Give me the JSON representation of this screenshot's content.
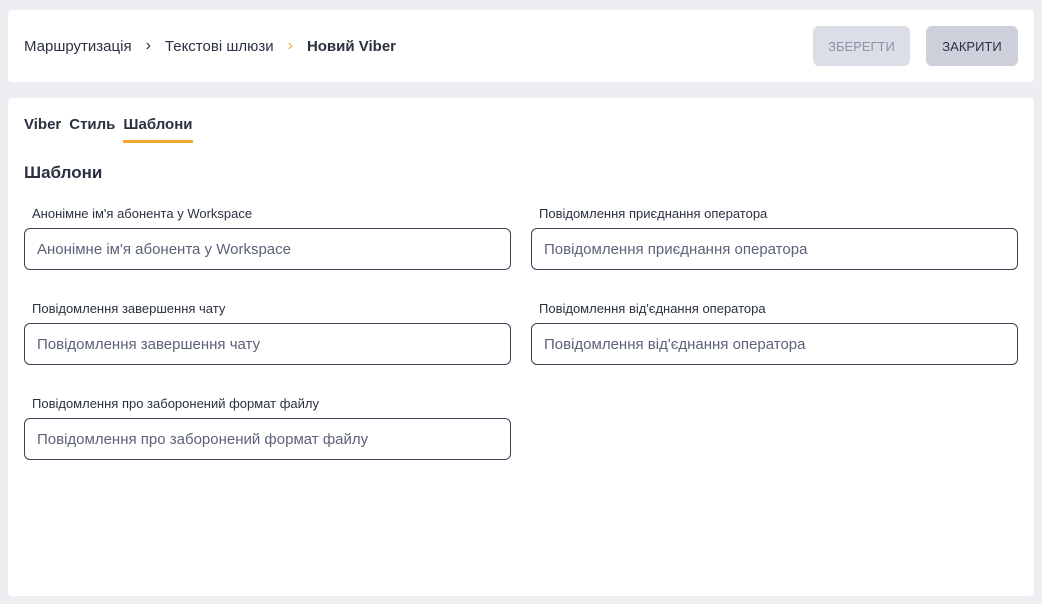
{
  "breadcrumb": {
    "items": [
      "Маршрутизація",
      "Текстові шлюзи"
    ],
    "current": "Новий Viber",
    "separator": "›"
  },
  "header": {
    "save_label": "ЗБЕРЕГТИ",
    "close_label": "ЗАКРИТИ"
  },
  "tabs": [
    {
      "label": "Viber",
      "active": false
    },
    {
      "label": "Стиль",
      "active": false
    },
    {
      "label": "Шаблони",
      "active": true
    }
  ],
  "section": {
    "title": "Шаблони"
  },
  "fields": [
    {
      "label": "Анонімне ім'я абонента у Workspace",
      "placeholder": "Анонімне ім'я абонента у Workspace",
      "value": ""
    },
    {
      "label": "Повідомлення приєднання оператора",
      "placeholder": "Повідомлення приєднання оператора",
      "value": ""
    },
    {
      "label": "Повідомлення завершення чату",
      "placeholder": "Повідомлення завершення чату",
      "value": ""
    },
    {
      "label": "Повідомлення від'єднання оператора",
      "placeholder": "Повідомлення від'єднання оператора",
      "value": ""
    },
    {
      "label": "Повідомлення про заборонений формат файлу",
      "placeholder": "Повідомлення про заборонений формат файлу",
      "value": ""
    }
  ],
  "colors": {
    "accent": "#f3a52b",
    "background": "#eceef2",
    "text": "#2a3140"
  }
}
